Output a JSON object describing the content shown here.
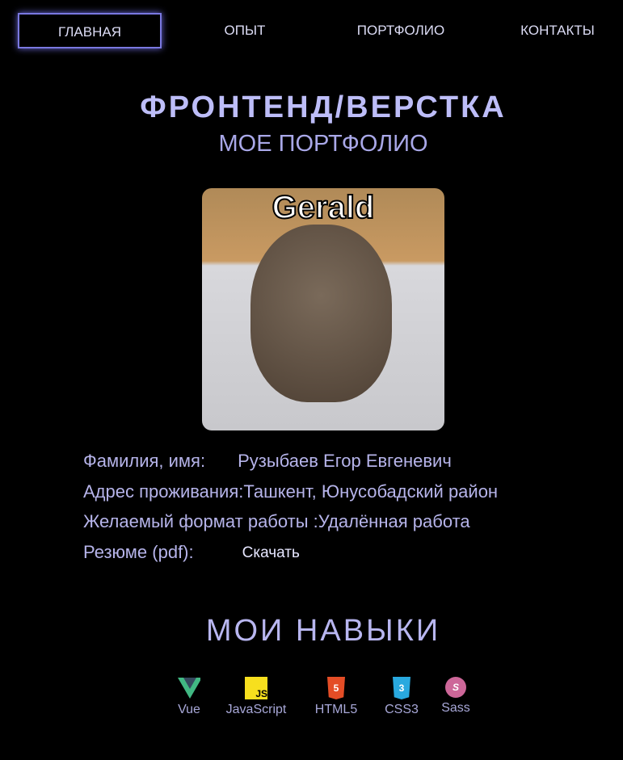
{
  "nav": [
    "ГЛАВНАЯ",
    "ОПЫТ",
    "ПОРТФОЛИО",
    "КОНТАКТЫ"
  ],
  "header": {
    "title": "ФРОНТЕНД/ВЕРСТКА",
    "subtitle": "МОЕ ПОРТФОЛИО"
  },
  "photo": {
    "caption": "Gerald"
  },
  "info": [
    {
      "k": "Фамилия, имя:",
      "v": "Рузыбаев Егор Евгеневич"
    },
    {
      "k": "Адрес проживания:",
      "v": "Ташкент, Юнусобадский район"
    },
    {
      "k": "Желаемый формат работы :",
      "v": "Удалённая работа"
    },
    {
      "k": "Резюме (pdf):",
      "v": "Скачать"
    }
  ],
  "skills": {
    "title": "МОИ НАВЫКИ",
    "items": [
      "Vue",
      "JavaScript",
      "HTML5",
      "CSS3",
      "Sass"
    ],
    "icon_text": {
      "js": "JS",
      "html": "5",
      "css": "3",
      "sass": "S"
    }
  }
}
